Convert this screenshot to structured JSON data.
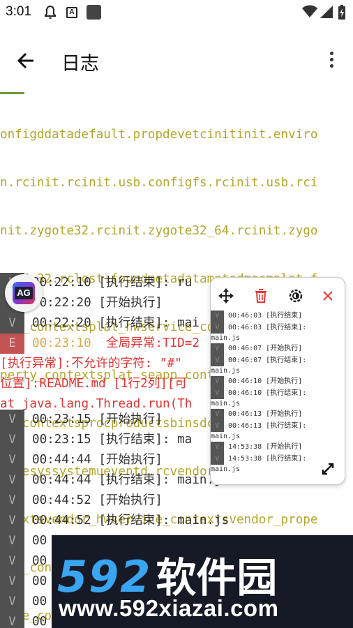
{
  "status_bar": {
    "time": "3:01",
    "notification_icons": [
      "bell-icon",
      "a-box-icon",
      "square-app-icon"
    ],
    "system_icons": [
      "wifi-icon",
      "signal-icon",
      "battery-charging-icon"
    ]
  },
  "app_bar": {
    "title": "日志",
    "back_icon": "arrow-left-icon",
    "menu_icon": "more-vert-icon"
  },
  "log": {
    "wrapped_olive_lines": [
      "onfigddatadefault.propdevetcinitinit.enviro",
      "n.rcinit.rcinit.usb.configfs.rcinit.usb.rci",
      "nit.zygote32.rcinit.zygote32_64.rcinit.zygo",
      "te64_32.rclost+foundmetadatamntodmoemplat_f",
      "ile_contextsplat_hwservice_contextsplat_pro",
      "perty_contextsplat_seapp_contextsplat_servi",
      "ce_contextsprocproductsbinsdcardsepolicysto",
      "ragesyssystemueventd.rcvendorvendor_file_co",
      "ntextsvendor_hwservice_contextsvendor_prope",
      "rty_contextsvendor_seapp_contextsvendor_ser",
      "vice_contextsvndservice_contexts"
    ],
    "rows": [
      {
        "level": "V",
        "text": "00:22:10 [执行结束]: ru"
      },
      {
        "level": "V",
        "text": "00:22:20 [开始执行]"
      },
      {
        "level": "V",
        "text": "00:22:20 [执行结束]: mai"
      },
      {
        "level": "E",
        "time": "00:23:10",
        "text": "全局异常:TID=2"
      }
    ],
    "error_lines": [
      "[执行异常]:不允许的字符: \"#\"",
      "位置]:README.md [1行2列][可",
      "at java.lang.Thread.run(Th"
    ],
    "rows_after": [
      {
        "level": "V",
        "text": "00:23:15 [开始执行]"
      },
      {
        "level": "V",
        "text": "00:23:15 [执行结束]: ma"
      },
      {
        "level": "V",
        "text": "00:44:44 [开始执行]"
      },
      {
        "level": "V",
        "text": "00:44:44 [执行结束]: main.js"
      },
      {
        "level": "V",
        "text": "00:44:52 [开始执行]"
      },
      {
        "level": "V",
        "text": "00:44:52 [执行结束]: main.js"
      },
      {
        "level": "V",
        "text": "00"
      },
      {
        "level": "V",
        "text": "00"
      },
      {
        "level": "V",
        "text": "00"
      },
      {
        "level": "V",
        "text": "00"
      },
      {
        "level": "V",
        "text": "00"
      }
    ]
  },
  "fab": {
    "label": "AG"
  },
  "floating_console": {
    "toolbar": [
      "move-icon",
      "trash-icon",
      "settings-icon",
      "close-icon"
    ],
    "lines": [
      {
        "level": "V",
        "text": "00:46:03 [执行结束]"
      },
      {
        "level": "V",
        "text": "00:46:03 [执行结束]:",
        "wrap": "main.js"
      },
      {
        "level": "V",
        "text": "00:46:07 [开始执行]"
      },
      {
        "level": "V",
        "text": "00:46:07 [执行结束]:",
        "wrap": "main.js"
      },
      {
        "level": "V",
        "text": "00:46:10 [开始执行]"
      },
      {
        "level": "V",
        "text": "00:46:10 [执行结束]:",
        "wrap": "main.js"
      },
      {
        "level": "V",
        "text": "00:46:13 [开始执行]"
      },
      {
        "level": "V",
        "text": "00:46:13 [执行结束]:",
        "wrap": "main.js"
      },
      {
        "level": "V",
        "text": "14:53:38 [开始执行]"
      },
      {
        "level": "V",
        "text": "14:53:38 [执行结束]:",
        "wrap": "main.js"
      }
    ],
    "expand_icon": "expand-diagonal-icon"
  },
  "watermark": {
    "number": "592",
    "name": "软件园",
    "url": "www.592xiazai.com"
  }
}
